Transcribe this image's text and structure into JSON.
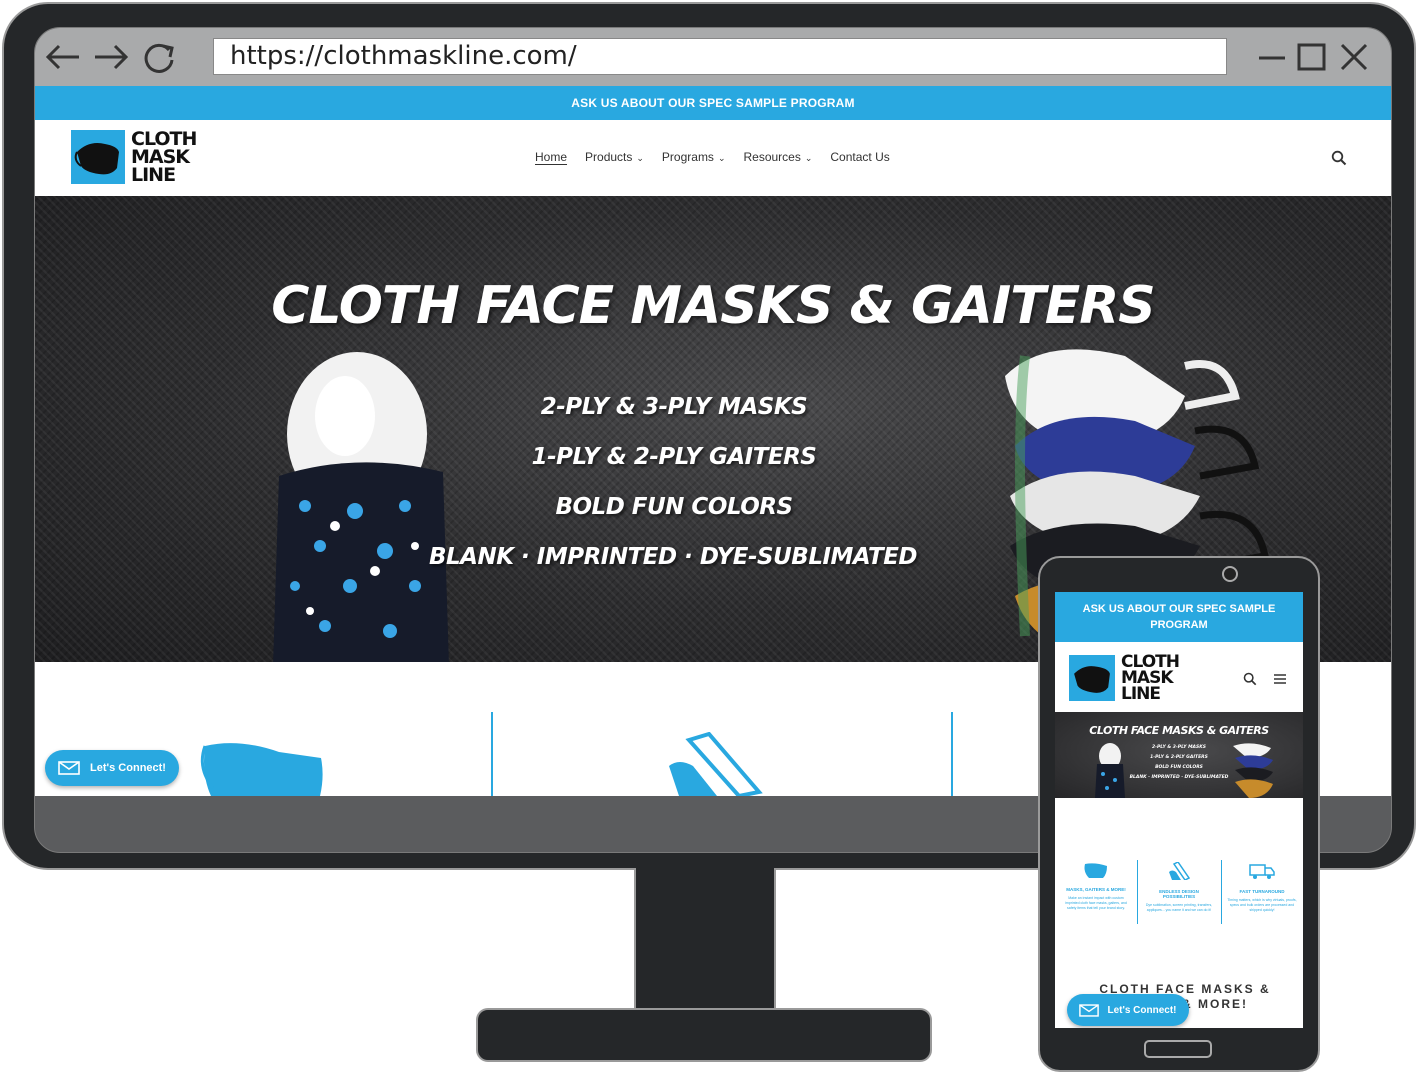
{
  "browser": {
    "url": "https://clothmaskline.com/"
  },
  "site": {
    "announcement": "ASK US ABOUT OUR SPEC SAMPLE PROGRAM",
    "logo": {
      "line1": "CLOTH",
      "line2": "MASK",
      "line3": "LINE"
    },
    "nav": [
      {
        "label": "Home"
      },
      {
        "label": "Products"
      },
      {
        "label": "Programs"
      },
      {
        "label": "Resources"
      },
      {
        "label": "Contact Us"
      }
    ],
    "hero": {
      "title": "CLOTH FACE MASKS & GAITERS",
      "lines": [
        "2-PLY & 3-PLY MASKS",
        "1-PLY & 2-PLY GAITERS",
        "BOLD FUN COLORS",
        "BLANK · IMPRINTED · DYE-SUBLIMATED"
      ]
    },
    "lets_connect": "Let's Connect!"
  },
  "mobile": {
    "announcement": "ASK US ABOUT OUR SPEC SAMPLE PROGRAM",
    "logo": {
      "line1": "CLOTH",
      "line2": "MASK",
      "line3": "LINE"
    },
    "hero": {
      "title": "CLOTH FACE MASKS & GAITERS",
      "lines": [
        "2-PLY & 3-PLY MASKS",
        "1-PLY & 2-PLY GAITERS",
        "BOLD FUN COLORS",
        "BLANK · IMPRINTED · DYE-SUBLIMATED"
      ]
    },
    "features": [
      {
        "title": "MASKS, GAITERS & MORE!",
        "desc": "Make an instant impact with custom imprinted cloth face masks, gaiters, and safety items that tell your brand story."
      },
      {
        "title": "ENDLESS DESIGN POSSIBILITIES",
        "desc": "Dye sublimation, screen printing, transfers, appliques... you name it and we can do it!"
      },
      {
        "title": "FAST TURNAROUND",
        "desc": "Timing matters, which is why virtuals, proofs, specs and bulk orders are processed and shipped quickly!"
      }
    ],
    "bottom_title_line1": "CLOTH FACE MASKS &",
    "bottom_title_line2": "& MORE!",
    "lets_connect": "Let's Connect!"
  },
  "colors": {
    "accent": "#29a8e0",
    "device": "#252729"
  }
}
